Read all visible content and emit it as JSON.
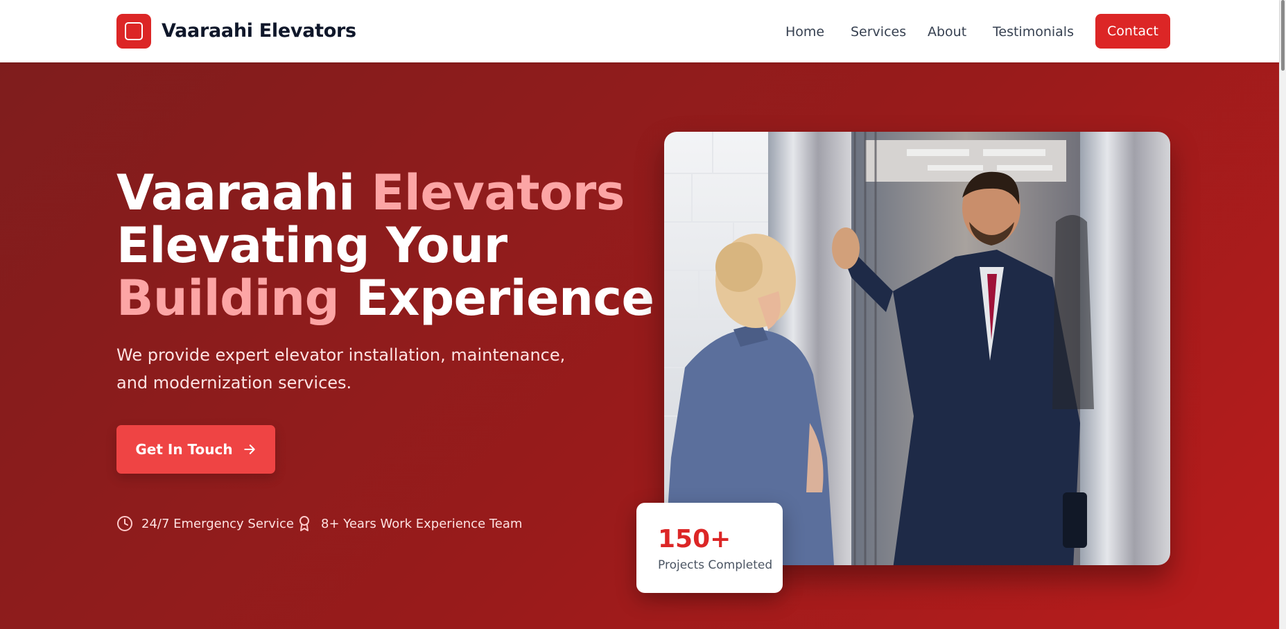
{
  "nav": {
    "brand": "Vaaraahi Elevators",
    "links": [
      "Home",
      "Services",
      "About",
      "Testimonials"
    ],
    "contact": "Contact"
  },
  "hero": {
    "headline_line1_a": "Vaaraahi ",
    "headline_line1_b": "Elevators",
    "headline_line2": "Elevating Your",
    "headline_line3_a": "Building",
    "headline_line3_b": " Experience",
    "subtext": "We provide expert elevator installation, maintenance, and modernization services.",
    "cta": "Get In Touch",
    "features": [
      "24/7 Emergency Service",
      "8+ Years Work Experience Team"
    ]
  },
  "stat": {
    "number": "150+",
    "label": "Projects Completed"
  },
  "icons": {
    "logo": "square-icon",
    "cta": "arrow-right-icon",
    "feature1": "clock-icon",
    "feature2": "award-icon"
  },
  "colors": {
    "brand": "#dc2626",
    "hero_bg": "#991b1b",
    "accent_text": "#fca5a5",
    "cta_bg": "#ef4444"
  }
}
